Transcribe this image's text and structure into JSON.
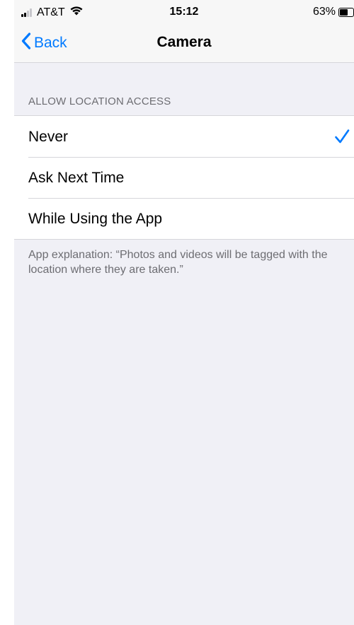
{
  "status_bar": {
    "carrier": "AT&T",
    "time": "15:12",
    "battery": "63%",
    "battery_level": 0.63,
    "signal_bars_filled": 2,
    "signal_bars_total": 4
  },
  "nav": {
    "back_label": "Back",
    "title": "Camera"
  },
  "section": {
    "header": "ALLOW LOCATION ACCESS"
  },
  "options": [
    {
      "label": "Never",
      "selected": true
    },
    {
      "label": "Ask Next Time",
      "selected": false
    },
    {
      "label": "While Using the App",
      "selected": false
    }
  ],
  "footer": {
    "explanation": "App explanation: “Photos and videos will be tagged with the location where they are taken.”"
  },
  "colors": {
    "accent": "#007aff",
    "background": "#f0f0f6",
    "secondary_text": "#6d6d72"
  },
  "icons": {
    "back": "chevron-left-icon",
    "selected": "checkmark-icon",
    "wifi": "wifi-icon",
    "signal": "cellular-signal-icon",
    "battery": "battery-icon"
  }
}
